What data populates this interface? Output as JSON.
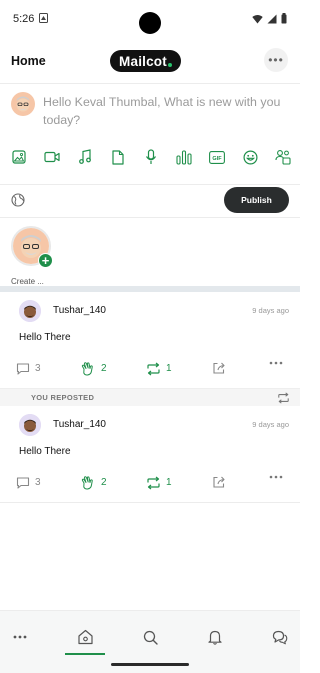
{
  "status": {
    "time": "5:26"
  },
  "header": {
    "title": "Home",
    "logo": "Mailcot",
    "more": "•••"
  },
  "composer": {
    "prompt": "Hello Keval Thumbal, What is new with you today?",
    "media_icons": [
      "image-icon",
      "video-icon",
      "music-icon",
      "document-icon",
      "microphone-icon",
      "poll-icon",
      "gif-icon",
      "emoji-icon",
      "group-icon"
    ],
    "gif_label": "GIF",
    "publish_label": "Publish"
  },
  "stories": {
    "create_label": "Create ..."
  },
  "posts": [
    {
      "username": "Tushar_140",
      "time": "9 days ago",
      "body": "Hello There",
      "comments": "3",
      "claps": "2",
      "reposts": "1"
    },
    {
      "username": "Tushar_140",
      "time": "9 days ago",
      "body": "Hello There",
      "comments": "3",
      "claps": "2",
      "reposts": "1"
    }
  ],
  "repost_banner": "YOU REPOSTED",
  "colors": {
    "accent": "#1f8f4a",
    "dark": "#2a2d2e",
    "logo_dot": "#27c26b"
  },
  "bottom_nav": [
    "more-icon",
    "home-icon",
    "search-icon",
    "bell-icon",
    "chat-icon"
  ]
}
